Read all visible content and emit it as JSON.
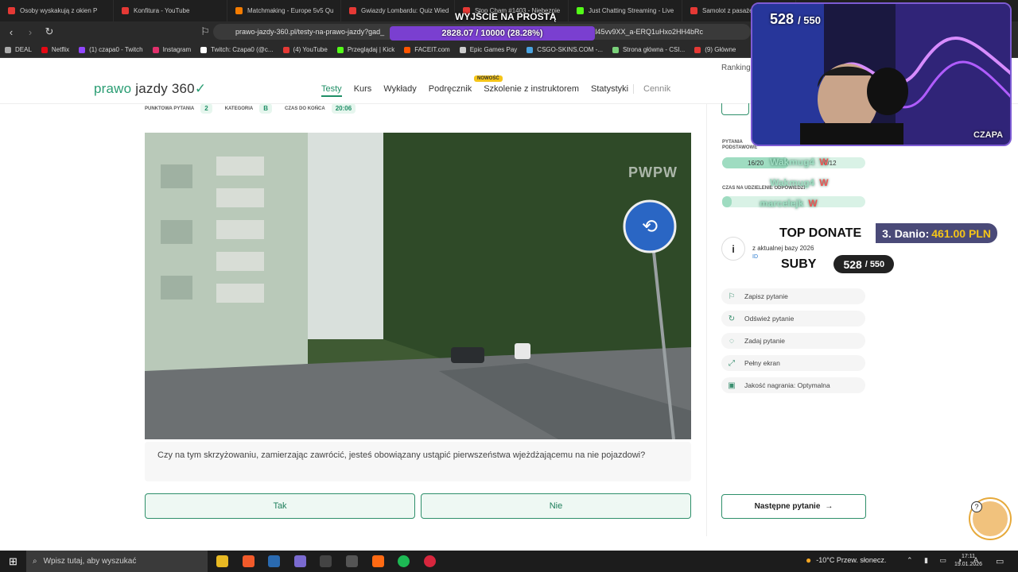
{
  "browser": {
    "tabs": [
      {
        "title": "Osoby wyskakują z okien P",
        "color": "#e53935"
      },
      {
        "title": "Konfitura - YouTube",
        "color": "#e53935"
      },
      {
        "title": "Matchmaking - Europe 5v5 Qu",
        "color": "#f57c00"
      },
      {
        "title": "Gwiazdy Lombardu: Quiz Wied",
        "color": "#e53935"
      },
      {
        "title": "Stop Cham #1403 - Niebezpie",
        "color": "#e53935"
      },
      {
        "title": "Just Chatting Streaming - Live",
        "color": "#53fc18"
      },
      {
        "title": "Samolot z pasażer",
        "color": "#e53935"
      }
    ],
    "url": "prawo-jazdy-360.pl/testy-na-prawo-jazdy?gad_",
    "url_tail": "d=0AAAAADkl45vv9XX_a-ERQ1uHxo2HH4bRc",
    "bookmarks": [
      {
        "label": "DEAL",
        "color": "#aaaaaa"
      },
      {
        "label": "Netflix",
        "color": "#e50914"
      },
      {
        "label": "(1) czapa0 - Twitch",
        "color": "#9146ff"
      },
      {
        "label": "Instagram",
        "color": "#e1306c"
      },
      {
        "label": "Twitch: Czapa0 (@c...",
        "color": "#ffffff"
      },
      {
        "label": "(4) YouTube",
        "color": "#e53935"
      },
      {
        "label": "Przeglądaj | Kick",
        "color": "#53fc18"
      },
      {
        "label": "FACEIT.com",
        "color": "#ff5500"
      },
      {
        "label": "Epic Games Pay",
        "color": "#cccccc"
      },
      {
        "label": "CSGO-SKINS.COM -...",
        "color": "#4aa3df"
      },
      {
        "label": "Strona główna - CSI...",
        "color": "#7ad17a"
      },
      {
        "label": "(9) Główne",
        "color": "#e53935"
      }
    ]
  },
  "site": {
    "logo_a": "prawo",
    "logo_b": "jazdy",
    "logo_c": "360",
    "nav": [
      "Testy",
      "Kurs",
      "Wykłady",
      "Podręcznik",
      "Szkolenie z instruktorem",
      "Statystyki"
    ],
    "new_badge": "NOWOŚĆ",
    "pricing": "Cennik",
    "ranking": "Ranking"
  },
  "exam": {
    "points_label": "PUNKTOWA PYTANIA",
    "points_value": "2",
    "category_label": "KATEGORIA",
    "category_value": "B",
    "time_label": "CZAS DO KOŃCA",
    "time_value": "20:06",
    "watermark": "PWPW",
    "question": "Czy na tym skrzyżowaniu, zamierzając zawrócić, jesteś obowiązany ustąpić pierwszeństwa wjeżdżającemu na nie pojazdowi?",
    "answer_yes": "Tak",
    "answer_no": "Nie"
  },
  "sidebar": {
    "basic_label": "PYTANIA PODSTAWOWE",
    "basic_value": "16/20",
    "special_value": "0/12",
    "time_label": "CZAS NA UDZIELENIE ODPOWIEDZI",
    "base_info": "z aktualnej bazy 2026",
    "base_id": "ID",
    "menu": [
      {
        "label": "Zapisz pytanie",
        "icon": "bookmark-icon"
      },
      {
        "label": "Odśwież pytanie",
        "icon": "refresh-icon"
      },
      {
        "label": "Zadaj pytanie",
        "icon": "chat-icon"
      },
      {
        "label": "Pełny ekran",
        "icon": "fullscreen-icon"
      },
      {
        "label": "Jakość nagrania: Optymalna",
        "icon": "video-icon"
      }
    ],
    "next": "Następne pytanie"
  },
  "overlay": {
    "stream_title": "WYJŚCIE NA PROSTĄ",
    "progress": "2828.07 / 10000 (28.28%)",
    "progress_fraction": 0.2828,
    "subs_current": "528",
    "subs_goal": "/ 550",
    "cam_name": "CZAPA",
    "chat": [
      {
        "user": "Wakmug4",
        "msg": "W"
      },
      {
        "user": "Wakmug4",
        "msg": "W"
      },
      {
        "user": "marcelejk",
        "msg": "W"
      }
    ],
    "top_donate_label": "TOP DONATE",
    "top_donate_name": "3. Danio:",
    "top_donate_amount": "461.00 PLN",
    "subs_label": "SUBY",
    "subs2_current": "528",
    "subs2_goal": "/ 550"
  },
  "taskbar": {
    "search_placeholder": "Wpisz tutaj, aby wyszukać",
    "weather": "-10°C  Przew. słonecz.",
    "time": "17:11",
    "date": "19.01.2026"
  }
}
